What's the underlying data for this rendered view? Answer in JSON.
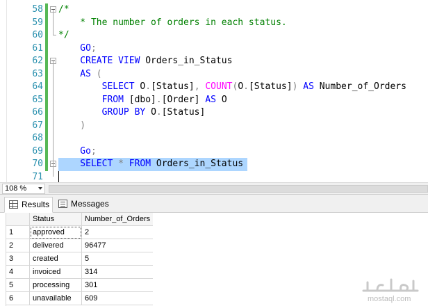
{
  "editor": {
    "lines": [
      {
        "num": "58",
        "tokens": [
          {
            "t": "/*",
            "c": "com"
          }
        ],
        "fold": true,
        "changed": true
      },
      {
        "num": "59",
        "tokens": [
          {
            "t": "    * The number of orders in each status.",
            "c": "com"
          }
        ],
        "changed": true
      },
      {
        "num": "60",
        "tokens": [
          {
            "t": "*/",
            "c": "com"
          }
        ],
        "changed": true
      },
      {
        "num": "61",
        "tokens": [
          {
            "t": "    GO",
            "c": "kw"
          },
          {
            "t": ";",
            "c": "gr"
          }
        ],
        "changed": true
      },
      {
        "num": "62",
        "tokens": [
          {
            "t": "    CREATE VIEW ",
            "c": "kw"
          },
          {
            "t": "Orders_in_Status",
            "c": "id"
          }
        ],
        "fold": true,
        "changed": true
      },
      {
        "num": "63",
        "tokens": [
          {
            "t": "    AS ",
            "c": "kw"
          },
          {
            "t": "(",
            "c": "gr"
          }
        ],
        "changed": true
      },
      {
        "num": "64",
        "tokens": [
          {
            "t": "        SELECT ",
            "c": "kw"
          },
          {
            "t": "O",
            "c": "id"
          },
          {
            "t": ".",
            "c": "gr"
          },
          {
            "t": "[Status]",
            "c": "id"
          },
          {
            "t": ", ",
            "c": "gr"
          },
          {
            "t": "COUNT",
            "c": "fn"
          },
          {
            "t": "(",
            "c": "gr"
          },
          {
            "t": "O",
            "c": "id"
          },
          {
            "t": ".",
            "c": "gr"
          },
          {
            "t": "[Status]",
            "c": "id"
          },
          {
            "t": ") ",
            "c": "gr"
          },
          {
            "t": "AS ",
            "c": "kw"
          },
          {
            "t": "Number_of_Orders",
            "c": "id"
          }
        ],
        "changed": true
      },
      {
        "num": "65",
        "tokens": [
          {
            "t": "        FROM ",
            "c": "kw"
          },
          {
            "t": "[dbo]",
            "c": "id"
          },
          {
            "t": ".",
            "c": "gr"
          },
          {
            "t": "[Order] ",
            "c": "id"
          },
          {
            "t": "AS ",
            "c": "kw"
          },
          {
            "t": "O",
            "c": "id"
          }
        ],
        "changed": true
      },
      {
        "num": "66",
        "tokens": [
          {
            "t": "        GROUP BY ",
            "c": "kw"
          },
          {
            "t": "O",
            "c": "id"
          },
          {
            "t": ".",
            "c": "gr"
          },
          {
            "t": "[Status]",
            "c": "id"
          }
        ],
        "changed": true
      },
      {
        "num": "67",
        "tokens": [
          {
            "t": "    )",
            "c": "gr"
          }
        ],
        "changed": true
      },
      {
        "num": "68",
        "tokens": [],
        "changed": true
      },
      {
        "num": "69",
        "tokens": [
          {
            "t": "    Go",
            "c": "kw"
          },
          {
            "t": ";",
            "c": "gr"
          }
        ],
        "changed": true
      },
      {
        "num": "70",
        "tokens": [
          {
            "t": "    SELECT ",
            "c": "kw"
          },
          {
            "t": "* ",
            "c": "gr"
          },
          {
            "t": "FROM ",
            "c": "kw"
          },
          {
            "t": "Orders_in_Status",
            "c": "id"
          }
        ],
        "fold": true,
        "changed": true,
        "selected": true
      },
      {
        "num": "71",
        "tokens": [],
        "changed": false,
        "caret": true
      }
    ]
  },
  "zoom": {
    "value": "108 %"
  },
  "tabs": [
    {
      "label": "Results",
      "icon": "grid-icon",
      "active": true
    },
    {
      "label": "Messages",
      "icon": "messages-icon",
      "active": false
    }
  ],
  "results": {
    "columns": [
      "Status",
      "Number_of_Orders"
    ],
    "rows": [
      {
        "n": "1",
        "status": "approved",
        "count": "2"
      },
      {
        "n": "2",
        "status": "delivered",
        "count": "96477"
      },
      {
        "n": "3",
        "status": "created",
        "count": "5"
      },
      {
        "n": "4",
        "status": "invoiced",
        "count": "314"
      },
      {
        "n": "5",
        "status": "processing",
        "count": "301"
      },
      {
        "n": "6",
        "status": "unavailable",
        "count": "609"
      }
    ]
  },
  "watermark": {
    "arabic": "مستقل",
    "latin": "mostaql.com"
  },
  "colors": {
    "comment": "#008000",
    "keyword": "#0000ff",
    "function": "#ff00ff",
    "gray": "#808080",
    "line_number": "#2b91af",
    "change_bar": "#57b856",
    "selection": "#add6ff"
  }
}
